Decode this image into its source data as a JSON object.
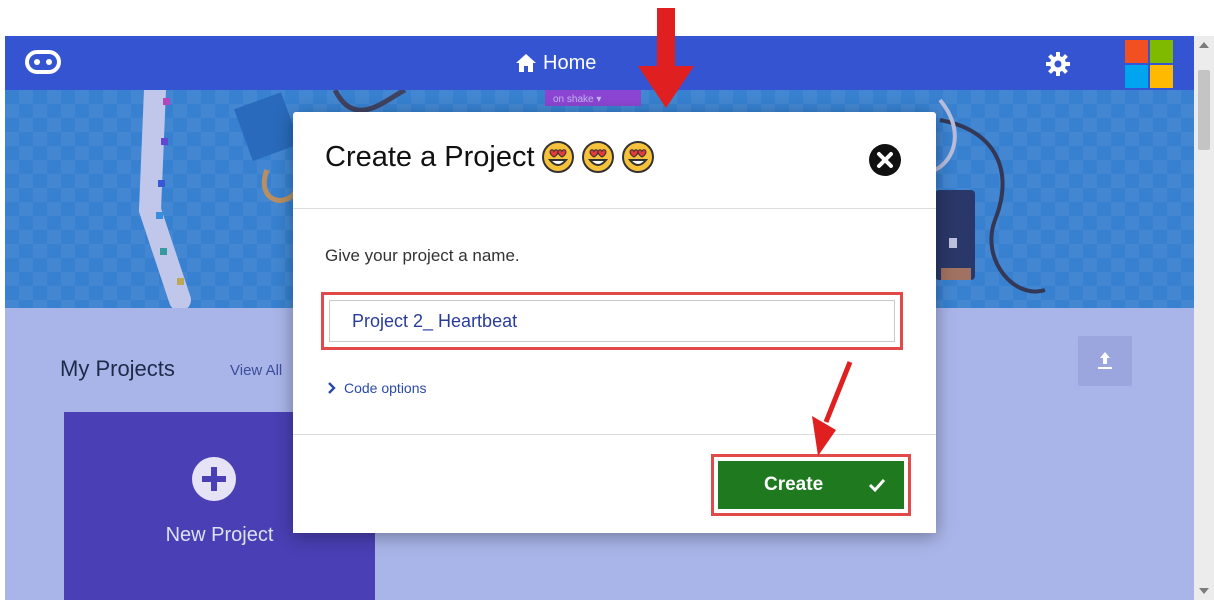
{
  "topbar": {
    "home_label": "Home"
  },
  "hero": {
    "badge_text": "on shake ▾"
  },
  "projects": {
    "title": "My Projects",
    "view_all": "View All",
    "new_project_label": "New Project"
  },
  "dialog": {
    "title": "Create a Project",
    "prompt": "Give your project a name.",
    "name_value": "Project 2_ Heartbeat",
    "code_options": "Code options",
    "create_label": "Create"
  },
  "colors": {
    "topbar": "#3454d1",
    "create_button": "#1f7a1f",
    "annotation": "#e02020",
    "new_project_card": "#4a3fb4"
  },
  "icons": [
    "microbit-logo-icon",
    "home-icon",
    "gear-icon",
    "microsoft-logo-icon",
    "close-icon",
    "heart-eyes-emoji-icon",
    "chevron-right-icon",
    "checkmark-icon",
    "upload-icon",
    "plus-circle-icon"
  ]
}
